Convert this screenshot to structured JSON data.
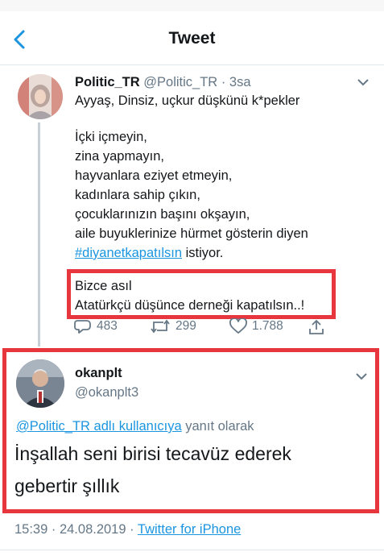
{
  "header": {
    "title": "Tweet"
  },
  "tweet": {
    "display_name": "Politic_TR",
    "handle": "@Politic_TR",
    "time": "· 3sa",
    "lines": [
      "Ayyaş, Dinsiz, uçkur düşkünü k*pekler",
      "İçki içmeyin,",
      "zina yapmayın,",
      "hayvanlara eziyet etmeyin,",
      "kadınlara sahip çıkın,",
      "çocuklarınızın başını okşayın,",
      "aile buyuklerinize hürmet gösterin diyen"
    ],
    "hashtag": "#diyanetkapatılsın",
    "hashtag_suffix": " istiyor.",
    "highlight_lines": [
      "Bizce asıl",
      "Atatürkçü düşünce derneği kapatılsın..!"
    ],
    "replies": "483",
    "retweets": "299",
    "likes": "1.788"
  },
  "reply": {
    "display_name": "okanplt",
    "handle": "@okanplt3",
    "reply_to_link": "@Politic_TR adlı kullanıcıya",
    "reply_to_suffix": " yanıt olarak",
    "lines": [
      "İnşallah seni birisi tecavüz ederek",
      "gebertir şıllık"
    ],
    "timestamp": "15:39 · 24.08.2019 · ",
    "source": "Twitter for iPhone"
  },
  "colors": {
    "link": "#1b95e0",
    "highlight_box": "#e8363f",
    "muted": "#657786"
  }
}
